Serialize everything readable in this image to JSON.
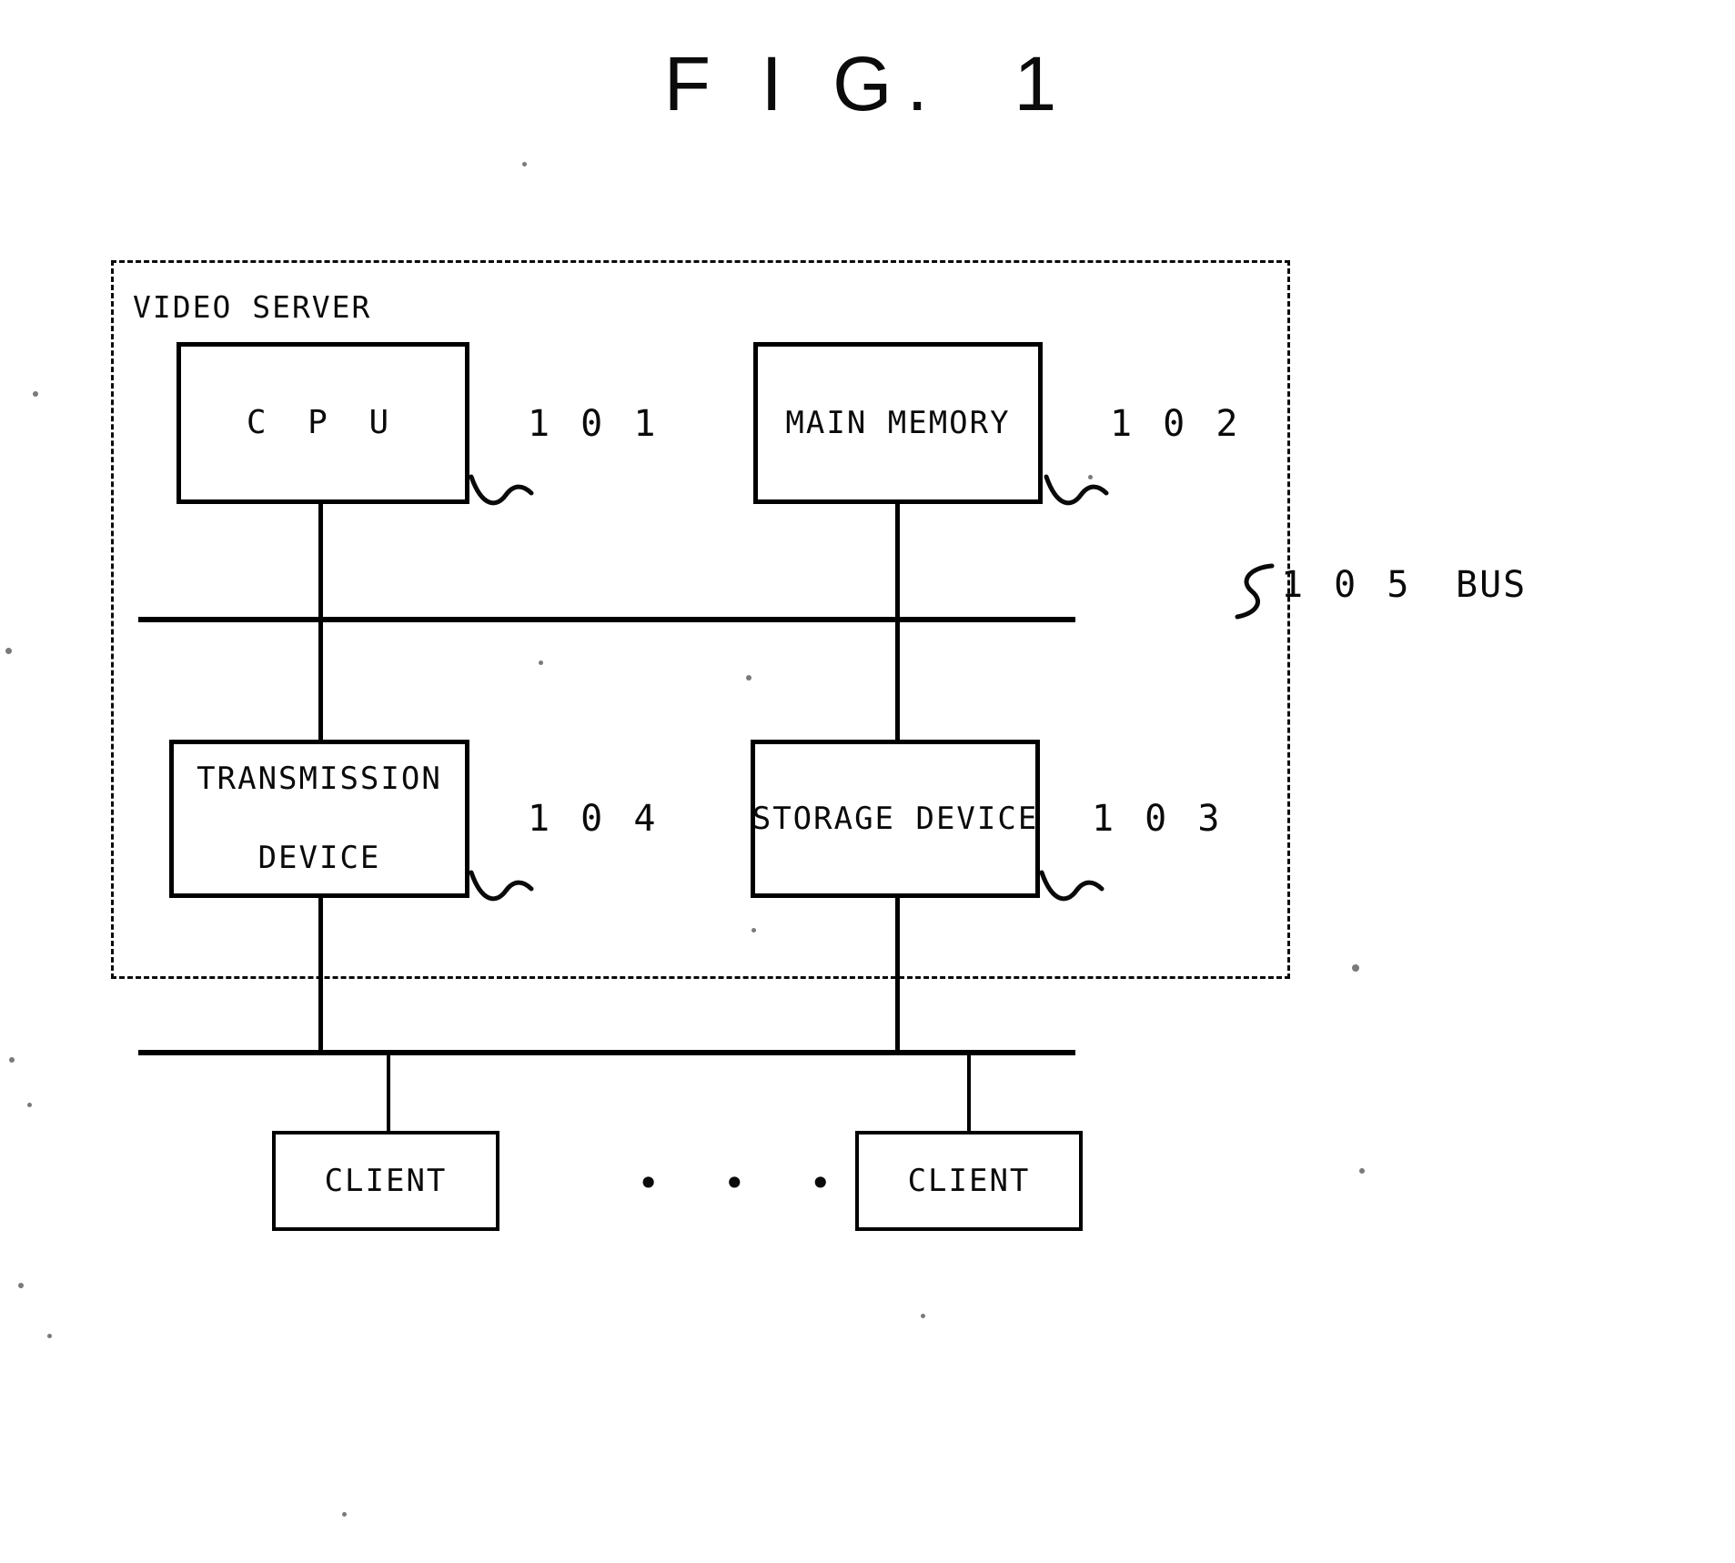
{
  "figure": {
    "title": "F I G.  1",
    "enclosure_label": "VIDEO SERVER"
  },
  "blocks": {
    "cpu": {
      "label": "C P U",
      "ref": "1 0 1"
    },
    "main_memory": {
      "label": "MAIN MEMORY",
      "ref": "1 0 2"
    },
    "transmission_device": {
      "label_line1": "TRANSMISSION",
      "label_line2": "DEVICE",
      "ref": "1 0 4"
    },
    "storage_device": {
      "label": "STORAGE DEVICE",
      "ref": "1 0 3"
    },
    "client_1": {
      "label": "CLIENT"
    },
    "client_2": {
      "label": "CLIENT"
    }
  },
  "bus": {
    "ref": "1 0 5",
    "name": "BUS"
  },
  "misc": {
    "ellipsis": "• • •"
  },
  "colors": {
    "ink": "#0a0a0a",
    "paper": "#ffffff"
  }
}
